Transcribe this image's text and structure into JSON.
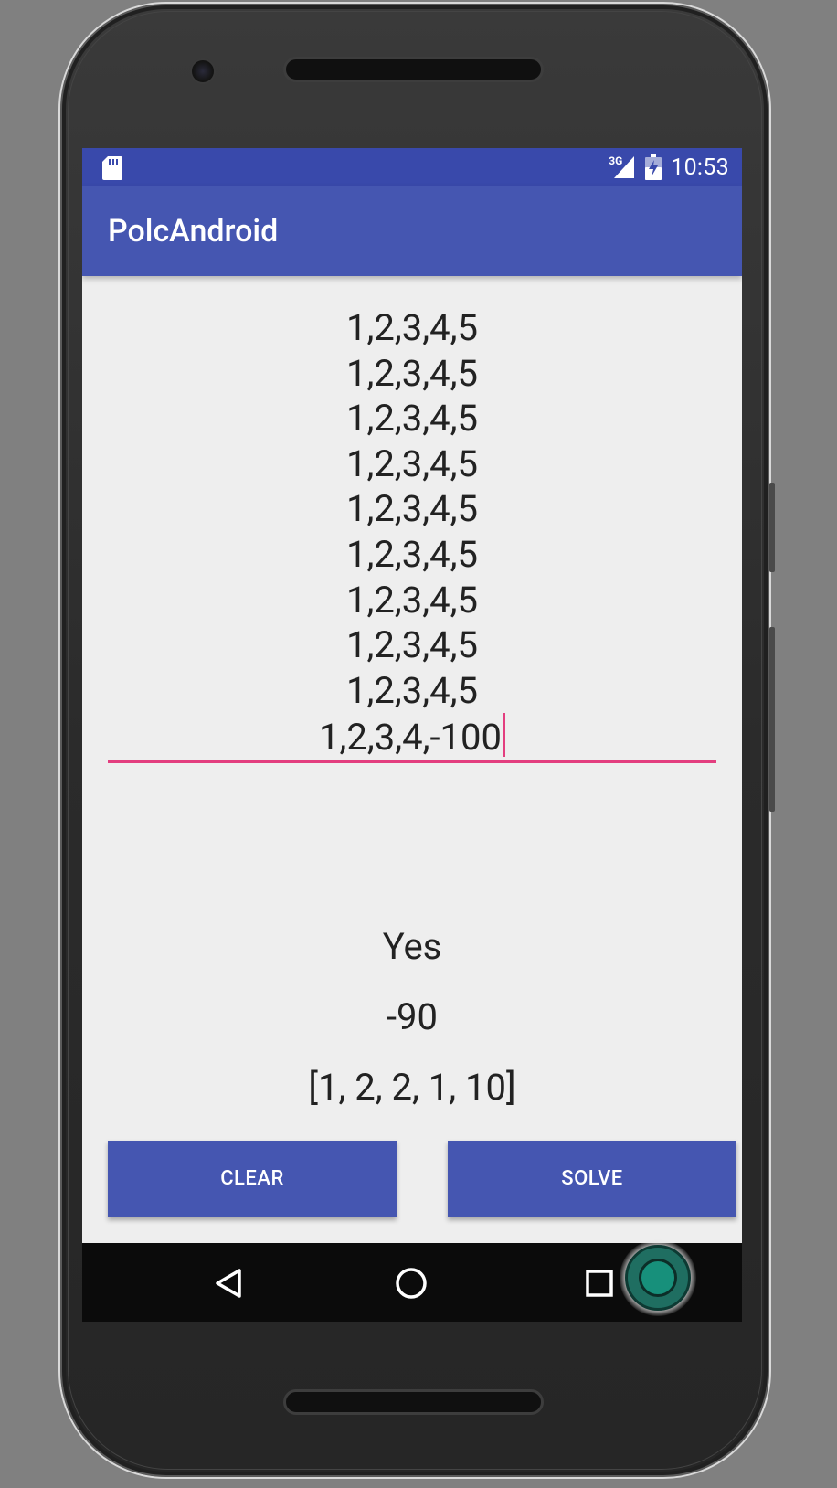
{
  "status_bar": {
    "network_label": "3G",
    "time": "10:53"
  },
  "app_bar": {
    "title": "PolcAndroid"
  },
  "input": {
    "lines": [
      "1,2,3,4,5",
      "1,2,3,4,5",
      "1,2,3,4,5",
      "1,2,3,4,5",
      "1,2,3,4,5",
      "1,2,3,4,5",
      "1,2,3,4,5",
      "1,2,3,4,5",
      "1,2,3,4,5",
      "1,2,3,4,-100"
    ],
    "accent_color": "#e33e7f"
  },
  "results": {
    "answer": "Yes",
    "value": "-90",
    "sequence": "[1, 2, 2, 1, 10]"
  },
  "buttons": {
    "clear_label": "CLEAR",
    "solve_label": "SOLVE"
  },
  "colors": {
    "primary": "#4556b1",
    "primary_dark": "#3949ab",
    "background": "#eeeeee"
  },
  "icons": {
    "status_left": "sd-card-icon",
    "signal": "signal-3g-icon",
    "battery": "battery-charging-icon",
    "nav_back": "back-triangle-icon",
    "nav_home": "home-circle-icon",
    "nav_recent": "recent-apps-square-icon",
    "overlay": "floating-record-icon"
  }
}
